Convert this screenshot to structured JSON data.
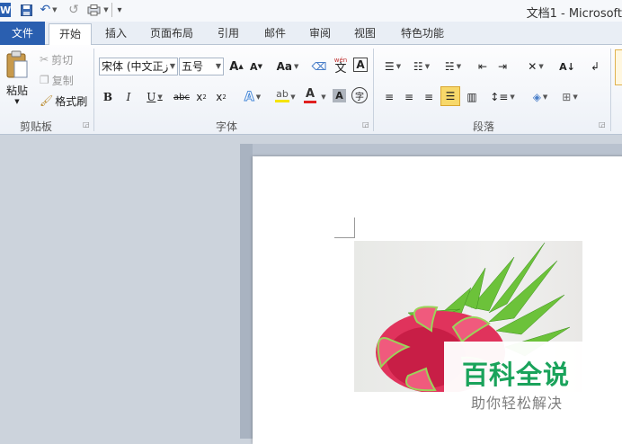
{
  "window": {
    "title": "文档1 - Microsoft"
  },
  "quick_access": {
    "app_icon_letter": "W",
    "undo_glyph": "↶",
    "redo_glyph": "↺",
    "customize_glyph": "▾"
  },
  "tabs": [
    {
      "label": "文件"
    },
    {
      "label": "开始"
    },
    {
      "label": "插入"
    },
    {
      "label": "页面布局"
    },
    {
      "label": "引用"
    },
    {
      "label": "邮件"
    },
    {
      "label": "审阅"
    },
    {
      "label": "视图"
    },
    {
      "label": "特色功能"
    }
  ],
  "clipboard": {
    "paste_label": "粘贴",
    "cut_label": "剪切",
    "copy_label": "复制",
    "format_painter_label": "格式刷",
    "group_label": "剪贴板"
  },
  "font": {
    "font_name": "宋体 (中文正ز",
    "font_size": "五号",
    "grow_label": "A",
    "shrink_label": "A",
    "case_label": "Aa",
    "bold_label": "B",
    "italic_label": "I",
    "underline_label": "U",
    "strike_label": "abc",
    "subscript_label": "x",
    "superscript_label": "x",
    "group_label": "字体",
    "pinyin_label": "文",
    "border_char_label": "A",
    "encircle_label": "字",
    "colors": {
      "highlight": "#f5e400",
      "font_color": "#e02020",
      "text_effect": "#4a8ad8"
    }
  },
  "paragraph": {
    "group_label": "段落"
  },
  "document": {
    "watermark_title": "百科全说",
    "watermark_subtitle": "助你轻松解决"
  }
}
